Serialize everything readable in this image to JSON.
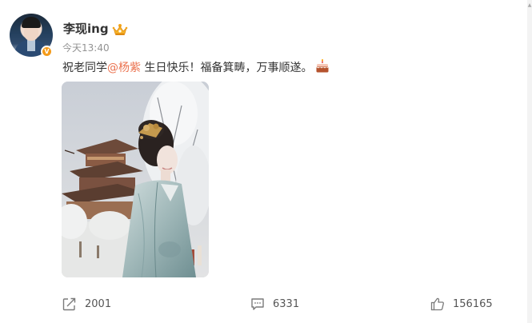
{
  "post": {
    "author": "李现ing",
    "timestamp": "今天13:40",
    "text_before": "祝老同学",
    "mention": "@杨紫",
    "text_after": " 生日快乐！福备箕畴，万事顺遂。",
    "verify_badge": "V",
    "avatar_icon": "user-avatar",
    "badge_icon": "crown-icon",
    "emoji_icon": "cake-icon"
  },
  "actions": {
    "repost_count": "2001",
    "comment_count": "6331",
    "like_count": "156165"
  },
  "colors": {
    "mention": "#eb7350",
    "timestamp": "#939393",
    "verify_badge": "#f49b1a"
  }
}
